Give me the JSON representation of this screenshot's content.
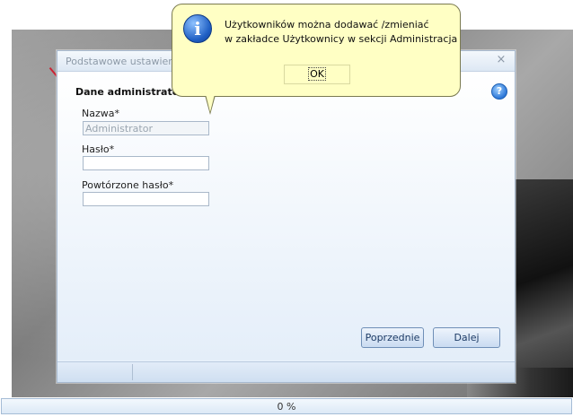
{
  "window": {
    "title": "Podstawowe ustawienia",
    "close_glyph": "×"
  },
  "form": {
    "section_title": "Dane administratora",
    "help_glyph": "?",
    "name_label": "Nazwa*",
    "name_value": "Administrator",
    "password_label": "Hasło*",
    "password_value": "",
    "repeat_label": "Powtórzone hasło*",
    "repeat_value": ""
  },
  "buttons": {
    "previous": "Poprzednie",
    "next": "Dalej"
  },
  "progress": {
    "text": "0 %",
    "value": 0
  },
  "balloon": {
    "icon_glyph": "i",
    "line1": "Użytkowników można dodawać /zmieniać",
    "line2": "w zakładce Użytkownicy w sekcji Administracja",
    "ok_label": "OK"
  },
  "colors": {
    "balloon_bg": "#ffffc4",
    "window_bg": "#eaf2fb",
    "accent_blue": "#2d78d8"
  }
}
